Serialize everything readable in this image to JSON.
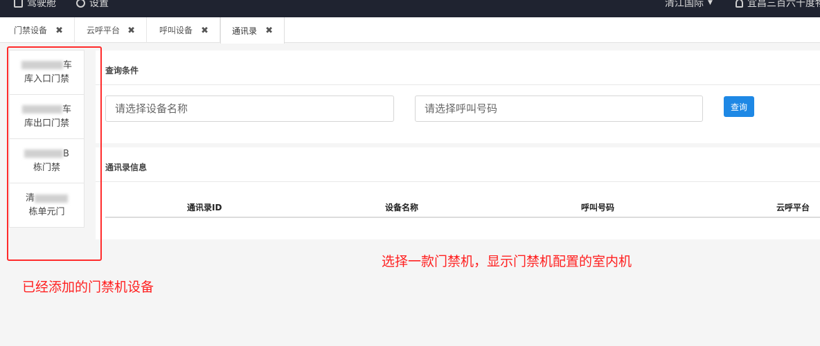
{
  "topbar": {
    "left_items": [
      {
        "label": "驾驶舱",
        "icon": "grid-icon"
      },
      {
        "label": "设置",
        "icon": "gear-icon"
      }
    ],
    "right_items": [
      {
        "label": "清江国际"
      },
      {
        "label": "宜昌三百六十度物",
        "icon": "user-icon"
      }
    ]
  },
  "tabs": [
    {
      "label": "门禁设备"
    },
    {
      "label": "云呼平台"
    },
    {
      "label": "呼叫设备"
    },
    {
      "label": "通讯录",
      "active": true
    }
  ],
  "devices": [
    {
      "line1": "车",
      "line2": "库入口门禁"
    },
    {
      "line1": "车",
      "line2": "库出口门禁"
    },
    {
      "line1": "B",
      "line2": "栋门禁"
    },
    {
      "line1": "清",
      "line2": "栋单元门"
    }
  ],
  "query": {
    "title": "查询条件",
    "device_placeholder": "请选择设备名称",
    "number_placeholder": "请选择呼叫号码",
    "search_label": "查询"
  },
  "contacts": {
    "title": "通讯录信息",
    "columns": [
      "通讯录ID",
      "设备名称",
      "呼叫号码",
      "云呼平台"
    ]
  },
  "annotations": {
    "left": "已经添加的门禁机设备",
    "right": "选择一款门禁机，显示门禁机配置的室内机"
  },
  "colors": {
    "topbar": "#1f2330",
    "primary": "#1e88e5",
    "annotation": "#ff2020"
  }
}
